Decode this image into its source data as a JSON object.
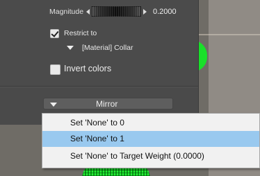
{
  "panel": {
    "magnitude": {
      "label": "Magnitude",
      "value": "0.2000"
    },
    "restrict": {
      "label": "Restrict to",
      "checked": true,
      "material": "[Material] Collar"
    },
    "invert": {
      "label": "Invert colors",
      "checked": false
    },
    "mirror": {
      "label": "Mirror"
    }
  },
  "menu": {
    "items": [
      {
        "label": "Set 'None' to 0",
        "highlighted": false
      },
      {
        "label": "Set 'None' to 1",
        "highlighted": true
      },
      {
        "label": "Set 'None' to Target Weight (0.0000)",
        "highlighted": false
      }
    ]
  },
  "colors": {
    "panel_bg": "#4a4a4a",
    "menu_highlight": "#99c9ef",
    "viewport_bg": "#6f6c66",
    "figure_green": "#19e02a"
  }
}
